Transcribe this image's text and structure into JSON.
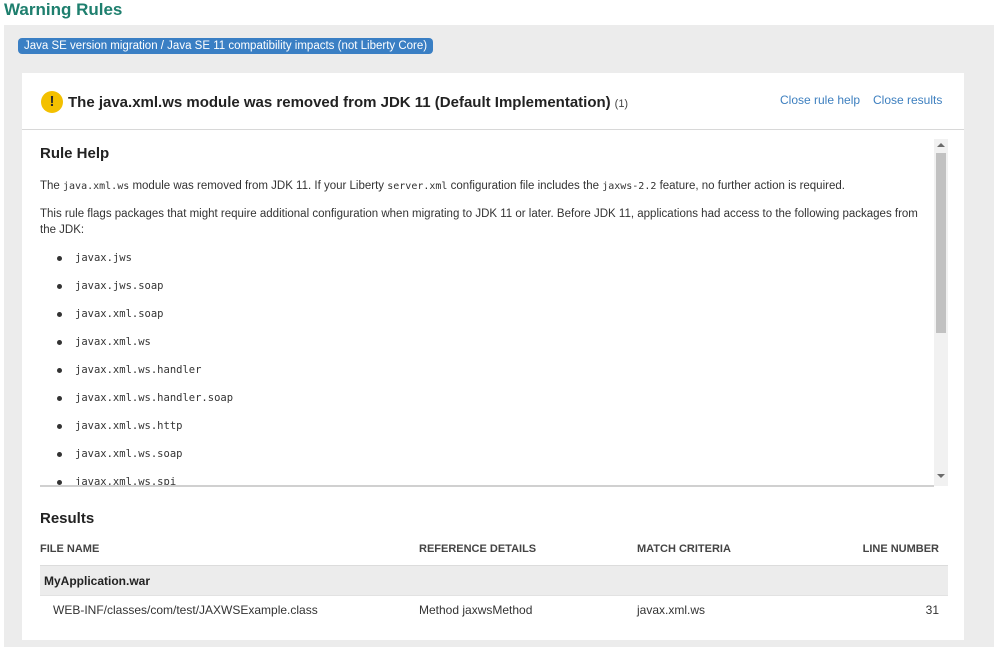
{
  "page": {
    "title": "Warning Rules"
  },
  "category": {
    "label": "Java SE version migration / Java SE 11 compatibility impacts (not Liberty Core)"
  },
  "rule": {
    "title": "The java.xml.ws module was removed from JDK 11 (Default Implementation)",
    "count": "(1)",
    "warning_icon": "exclamation-circle-icon",
    "close_rule_help_label": "Close rule help",
    "close_results_label": "Close results"
  },
  "help": {
    "heading": "Rule Help",
    "p1": {
      "t1": "The ",
      "c1": "java.xml.ws",
      "t2": " module was removed from JDK 11. If your Liberty ",
      "c2": "server.xml",
      "t3": " configuration file includes the ",
      "c3": "jaxws-2.2",
      "t4": " feature, no further action is required."
    },
    "p2": "This rule flags packages that might require additional configuration when migrating to JDK 11 or later. Before JDK 11, applications had access to the following packages from the JDK:",
    "packages": [
      "javax.jws",
      "javax.jws.soap",
      "javax.xml.soap",
      "javax.xml.ws",
      "javax.xml.ws.handler",
      "javax.xml.ws.handler.soap",
      "javax.xml.ws.http",
      "javax.xml.ws.soap",
      "javax.xml.ws.spi"
    ]
  },
  "results": {
    "heading": "Results",
    "columns": {
      "file_name": "FILE NAME",
      "reference_details": "REFERENCE DETAILS",
      "match_criteria": "MATCH CRITERIA",
      "line_number": "LINE NUMBER"
    },
    "groups": [
      {
        "name": "MyApplication.war",
        "rows": [
          {
            "file": "WEB-INF/classes/com/test/JAXWSExample.class",
            "reference": "Method jaxwsMethod",
            "match": "javax.xml.ws",
            "line": "31"
          }
        ]
      }
    ]
  },
  "colors": {
    "title_green": "#1e7f6e",
    "badge_blue": "#3a7fc4",
    "link_blue": "#3d7fbf",
    "warning_yellow": "#f3c000"
  }
}
